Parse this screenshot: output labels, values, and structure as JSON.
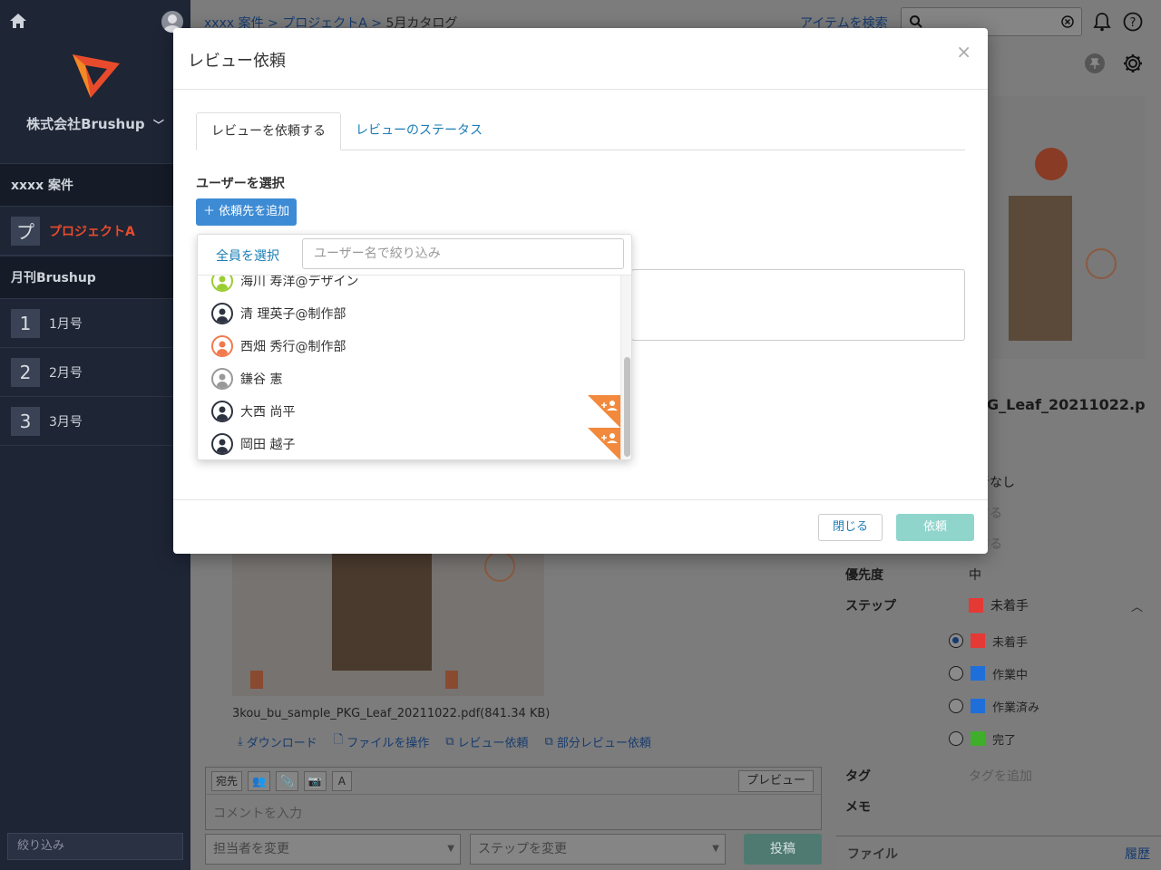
{
  "sidebar": {
    "company": "株式会社Brushup",
    "sections": [
      {
        "title": "xxxx 案件",
        "items": [
          {
            "badge": "プ",
            "label": "プロジェクトA",
            "active": true
          }
        ]
      },
      {
        "title": "月刊Brushup",
        "items": [
          {
            "badge": "1",
            "label": "1月号"
          },
          {
            "badge": "2",
            "label": "2月号"
          },
          {
            "badge": "3",
            "label": "3月号"
          }
        ]
      }
    ],
    "filter_placeholder": "絞り込み"
  },
  "header": {
    "breadcrumb": [
      "xxxx 案件",
      "プロジェクトA",
      "5月カタログ"
    ],
    "search_link": "アイテムを検索"
  },
  "item": {
    "file_name": "3kou_bu_sample_PKG_Leaf_20211022.pdf",
    "file_size": "(841.34 KB)",
    "side_file_name": "G_Leaf_20211022.p",
    "actions": [
      "ダウンロード",
      "ファイルを操作",
      "レビュー依頼",
      "部分レビュー依頼"
    ]
  },
  "comment": {
    "tools": [
      "宛先",
      "A"
    ],
    "preview": "プレビュー",
    "placeholder": "コメントを入力",
    "assignee_select": "担当者を変更",
    "step_select": "ステップを変更",
    "post": "投稿"
  },
  "properties": {
    "assignee_fragment": "当者なし",
    "muted_1": "きする",
    "muted_2": "きする",
    "priority_label": "優先度",
    "priority_value": "中",
    "step_label": "ステップ",
    "step_value": "未着手",
    "steps": [
      {
        "label": "未着手",
        "color": "#e53935",
        "checked": true
      },
      {
        "label": "作業中",
        "color": "#1e6fd9",
        "checked": false
      },
      {
        "label": "作業済み",
        "color": "#1e6fd9",
        "checked": false
      },
      {
        "label": "完了",
        "color": "#3fae2a",
        "checked": false
      }
    ],
    "tag_label": "タグ",
    "tag_placeholder": "タグを追加",
    "memo_label": "メモ",
    "file_label": "ファイル",
    "history_link": "履歴"
  },
  "modal": {
    "title": "レビュー依頼",
    "close_glyph": "×",
    "tabs": [
      "レビューを依頼する",
      "レビューのステータス"
    ],
    "select_user_label": "ユーザーを選択",
    "add_button": "依頼先を追加",
    "close_button": "閉じる",
    "request_button": "依頼"
  },
  "dropdown": {
    "select_all": "全員を選択",
    "filter_placeholder": "ユーザー名で絞り込み",
    "users": [
      {
        "name": "海川 寿洋@デザイン",
        "color": "#9acd32",
        "flag": false
      },
      {
        "name": "清 理英子@制作部",
        "color": "#2d3340",
        "flag": false
      },
      {
        "name": "西畑 秀行@制作部",
        "color": "#f07a4e",
        "flag": false
      },
      {
        "name": "鎌谷 憲",
        "color": "#999999",
        "flag": false
      },
      {
        "name": "大西 尚平",
        "color": "#2d3340",
        "flag": true
      },
      {
        "name": "岡田 越子",
        "color": "#2d3340",
        "flag": true
      }
    ]
  },
  "colors": {
    "accent": "#3d8bd4",
    "link": "#1b7db5",
    "brand_orange": "#e84b2c",
    "request_disabled": "#8fd5cc"
  }
}
